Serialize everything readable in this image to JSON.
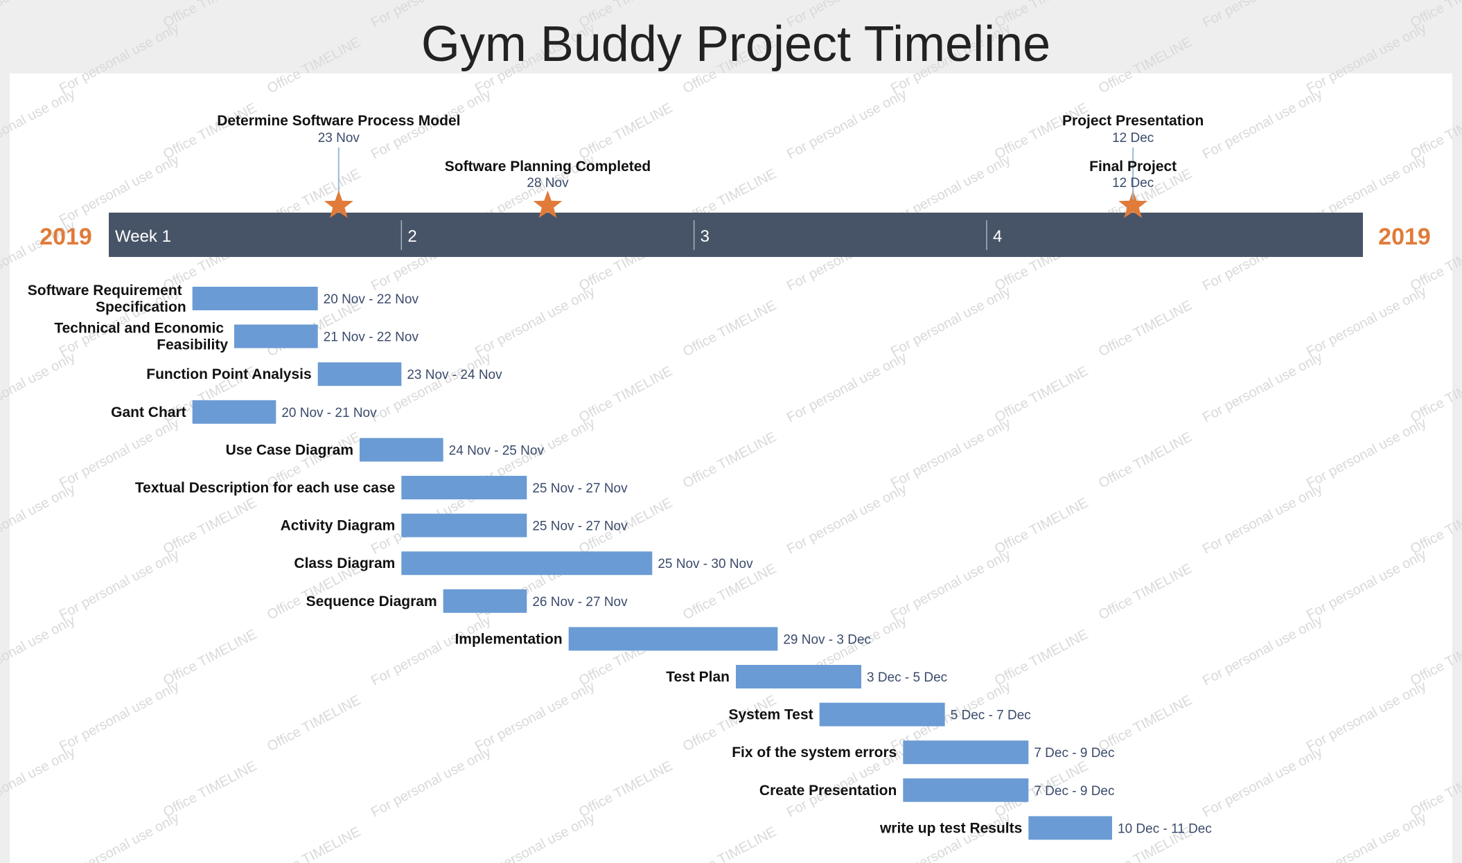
{
  "chart_data": {
    "type": "gantt",
    "title": "Gym Buddy Project Timeline",
    "year_label": "2019",
    "axis": {
      "start_date": "2019-11-18",
      "end_date": "2019-12-18",
      "ticks": [
        {
          "date": "2019-11-18",
          "label": "Week 1"
        },
        {
          "date": "2019-11-25",
          "label": "2"
        },
        {
          "date": "2019-12-02",
          "label": "3"
        },
        {
          "date": "2019-12-09",
          "label": "4"
        }
      ]
    },
    "milestones": [
      {
        "name": "Determine Software Process Model",
        "date": "2019-11-23",
        "date_label": "23 Nov",
        "tier": "upper"
      },
      {
        "name": "Software Planning Completed",
        "date": "2019-11-28",
        "date_label": "28 Nov",
        "tier": "lower"
      },
      {
        "name": "Project Presentation",
        "date": "2019-12-12",
        "date_label": "12 Dec",
        "tier": "upper"
      },
      {
        "name": "Final Project",
        "date": "2019-12-12",
        "date_label": "12 Dec",
        "tier": "lower"
      }
    ],
    "tasks": [
      {
        "name": "Software Requirement Specification",
        "start": "2019-11-20",
        "end": "2019-11-22",
        "date_label": "20 Nov - 22 Nov"
      },
      {
        "name": "Technical and Economic Feasibility",
        "start": "2019-11-21",
        "end": "2019-11-22",
        "date_label": "21 Nov - 22 Nov"
      },
      {
        "name": "Function Point Analysis",
        "start": "2019-11-23",
        "end": "2019-11-24",
        "date_label": "23 Nov - 24 Nov"
      },
      {
        "name": "Gant Chart",
        "start": "2019-11-20",
        "end": "2019-11-21",
        "date_label": "20 Nov - 21 Nov"
      },
      {
        "name": "Use Case Diagram",
        "start": "2019-11-24",
        "end": "2019-11-25",
        "date_label": "24 Nov - 25 Nov"
      },
      {
        "name": "Textual Description for each use case",
        "start": "2019-11-25",
        "end": "2019-11-27",
        "date_label": "25 Nov - 27 Nov"
      },
      {
        "name": "Activity Diagram",
        "start": "2019-11-25",
        "end": "2019-11-27",
        "date_label": "25 Nov - 27 Nov"
      },
      {
        "name": "Class Diagram",
        "start": "2019-11-25",
        "end": "2019-11-30",
        "date_label": "25 Nov - 30 Nov"
      },
      {
        "name": "Sequence Diagram",
        "start": "2019-11-26",
        "end": "2019-11-27",
        "date_label": "26 Nov - 27 Nov"
      },
      {
        "name": "Implementation",
        "start": "2019-11-29",
        "end": "2019-12-03",
        "date_label": "29 Nov - 3 Dec"
      },
      {
        "name": "Test Plan",
        "start": "2019-12-03",
        "end": "2019-12-05",
        "date_label": "3 Dec - 5 Dec"
      },
      {
        "name": "System Test",
        "start": "2019-12-05",
        "end": "2019-12-07",
        "date_label": "5 Dec - 7 Dec"
      },
      {
        "name": "Fix of the system errors",
        "start": "2019-12-07",
        "end": "2019-12-09",
        "date_label": "7 Dec - 9 Dec"
      },
      {
        "name": "Create Presentation",
        "start": "2019-12-07",
        "end": "2019-12-09",
        "date_label": "7 Dec - 9 Dec"
      },
      {
        "name": "write up test Results",
        "start": "2019-12-10",
        "end": "2019-12-11",
        "date_label": "10 Dec - 11 Dec"
      }
    ]
  },
  "watermark": {
    "line1": "For personal use only",
    "line2": "Office TIMELINE"
  },
  "colors": {
    "axis_bar": "#475467",
    "task_bar": "#6a9bd4",
    "milestone": "#e07b39",
    "year_text": "#e07b39",
    "task_label": "#111111",
    "date_text": "#3a4a6a",
    "title": "#222222",
    "panel": "#ffffff",
    "background": "#eeeeee",
    "connector": "#9db8d6"
  }
}
